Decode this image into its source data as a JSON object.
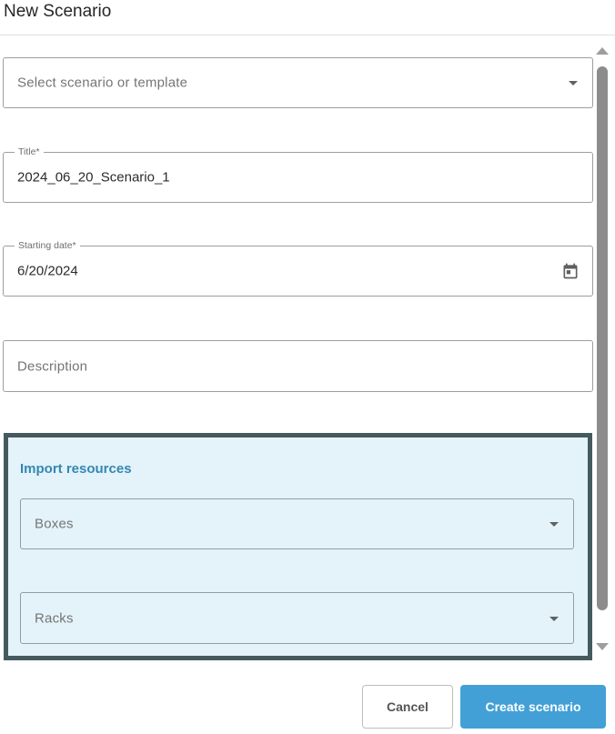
{
  "dialog": {
    "title": "New Scenario"
  },
  "form": {
    "scenario_select": {
      "placeholder": "Select scenario or template",
      "icon": "chevron-down-icon"
    },
    "title_field": {
      "label": "Title*",
      "value": "2024_06_20_Scenario_1"
    },
    "start_date_field": {
      "label": "Starting date*",
      "value": "6/20/2024",
      "icon": "calendar-icon"
    },
    "description_field": {
      "placeholder": "Description"
    }
  },
  "import_resources": {
    "title": "Import resources",
    "highlight_color": "#e3f3f9",
    "border_color": "#455a5f",
    "boxes_select": {
      "placeholder": "Boxes",
      "icon": "chevron-down-icon"
    },
    "racks_select": {
      "placeholder": "Racks",
      "icon": "chevron-down-icon"
    }
  },
  "actions": {
    "cancel_label": "Cancel",
    "create_label": "Create scenario",
    "primary_color": "#42a0d7"
  }
}
